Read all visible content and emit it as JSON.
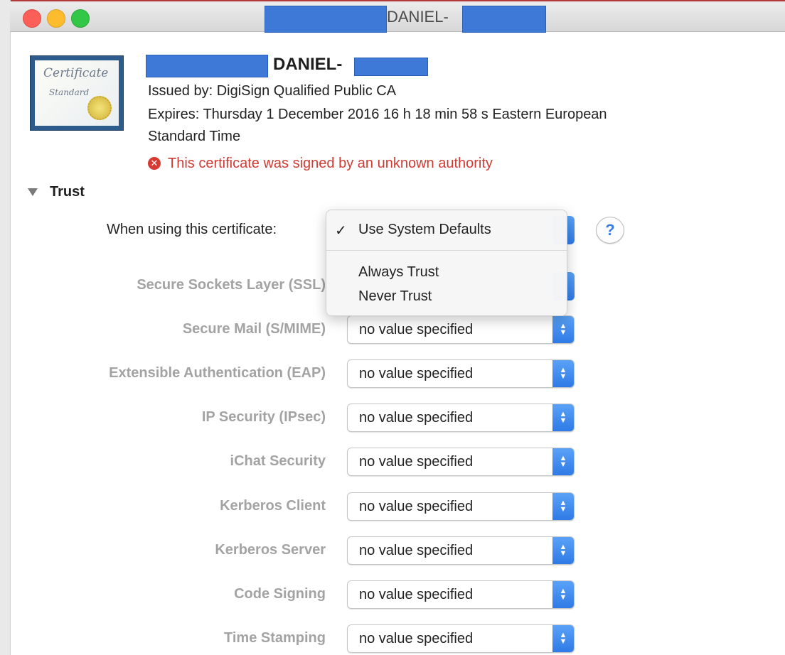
{
  "window": {
    "title_suffix": "DANIEL-"
  },
  "certificate": {
    "icon_word_1": "Certificate",
    "icon_word_2": "Standard",
    "name_suffix": "DANIEL-",
    "issued_by": "Issued by: DigiSign Qualified Public CA",
    "expires_line_1": "Expires: Thursday 1 December 2016 16 h 18 min 58 s Eastern European",
    "expires_line_2": "Standard Time",
    "warning_icon": "x-circle-icon",
    "warning": "This certificate was signed by an unknown authority",
    "warning_color": "#d13a32"
  },
  "trust": {
    "header": "Trust",
    "when_using_label": "When using this certificate:",
    "help_label": "?",
    "menu": {
      "check_mark": "✓",
      "items": [
        "Use System Defaults",
        "Always Trust",
        "Never Trust"
      ],
      "selected_index": 0
    },
    "rows": [
      {
        "label": "Secure Sockets Layer (SSL)",
        "value": ""
      },
      {
        "label": "Secure Mail (S/MIME)",
        "value": "no value specified"
      },
      {
        "label": "Extensible Authentication (EAP)",
        "value": "no value specified"
      },
      {
        "label": "IP Security (IPsec)",
        "value": "no value specified"
      },
      {
        "label": "iChat Security",
        "value": "no value specified"
      },
      {
        "label": "Kerberos Client",
        "value": "no value specified"
      },
      {
        "label": "Kerberos Server",
        "value": "no value specified"
      },
      {
        "label": "Code Signing",
        "value": "no value specified"
      },
      {
        "label": "Time Stamping",
        "value": "no value specified"
      }
    ]
  },
  "colors": {
    "accent_blue": "#3b7de0",
    "redaction_blue": "#3f79d8"
  }
}
